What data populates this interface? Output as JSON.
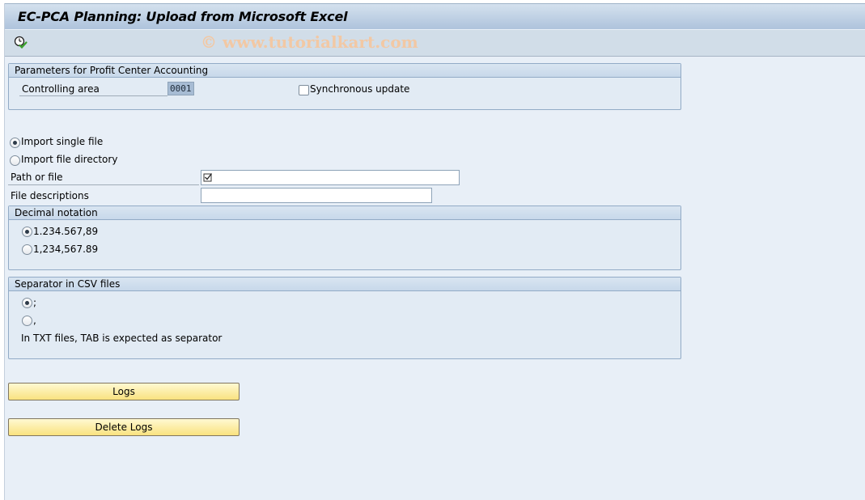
{
  "window": {
    "title": "EC-PCA Planning: Upload from Microsoft Excel"
  },
  "toolbar": {
    "execute_icon": "execute-clock-check-icon",
    "watermark": "© www.tutorialkart.com"
  },
  "parameters_group": {
    "title": "Parameters for Profit Center Accounting",
    "controlling_area_label": "Controlling area",
    "controlling_area_value": "0001",
    "synchronous_update_label": "Synchronous update",
    "synchronous_update_checked": false
  },
  "import_mode": {
    "options": [
      {
        "label": "Import single file",
        "selected": true
      },
      {
        "label": "Import file directory",
        "selected": false
      }
    ]
  },
  "fields": {
    "path_label": "Path or file",
    "path_value": "",
    "path_icon": "checkbox-f4-icon",
    "file_descriptions_label": "File descriptions",
    "file_descriptions_value": ""
  },
  "decimal_group": {
    "title": "Decimal notation",
    "options": [
      {
        "label": "1.234.567,89",
        "selected": true
      },
      {
        "label": "1,234,567.89",
        "selected": false
      }
    ]
  },
  "separator_group": {
    "title": "Separator in CSV files",
    "options": [
      {
        "label": ";",
        "selected": true
      },
      {
        "label": ",",
        "selected": false
      }
    ],
    "note": "In TXT files, TAB is expected as separator"
  },
  "buttons": {
    "logs_label": "Logs",
    "delete_logs_label": "Delete Logs"
  }
}
